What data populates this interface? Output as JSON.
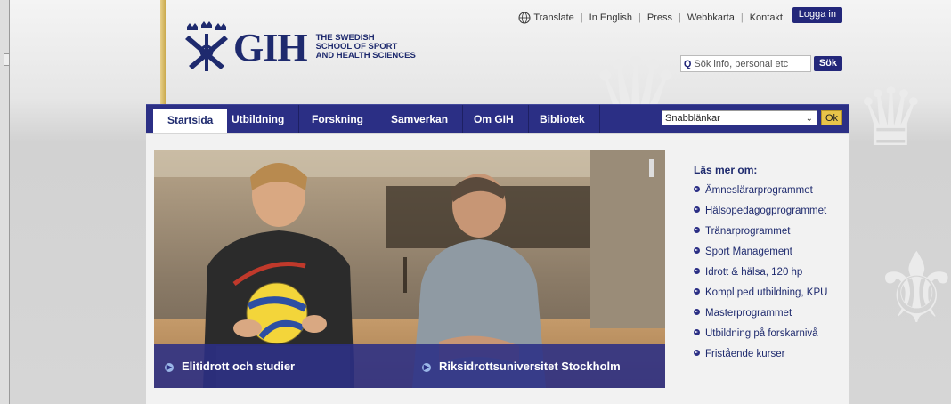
{
  "header": {
    "logo_text": "GIH",
    "logo_subtitle": [
      "THE SWEDISH",
      "SCHOOL OF SPORT",
      "AND HEALTH SCIENCES"
    ],
    "top_links": [
      "Translate",
      "In English",
      "Press",
      "Webbkarta",
      "Kontakt"
    ],
    "login_label": "Logga in",
    "search_placeholder": "Sök info, personal etc",
    "search_button": "Sök",
    "brand_color": "#2b2f85",
    "accent_color": "#e8c44a"
  },
  "nav": {
    "items": [
      "Startsida",
      "Utbildning",
      "Forskning",
      "Samverkan",
      "Om GIH",
      "Bibliotek"
    ],
    "active": "Startsida",
    "quick_links_label": "Snabblänkar",
    "ok_label": "Ok"
  },
  "hero": {
    "captions": [
      "Elitidrott och studier",
      "Riksidrottsuniversitet Stockholm"
    ]
  },
  "sidebar": {
    "heading": "Läs mer om:",
    "links": [
      "Ämneslärarprogrammet",
      "Hälsopedagogprogrammet",
      "Tränarprogrammet",
      "Sport Management",
      "Idrott & hälsa, 120 hp",
      "Kompl ped utbildning, KPU",
      "Masterprogrammet",
      "Utbildning på forskarnivå",
      "Fristående kurser"
    ]
  }
}
